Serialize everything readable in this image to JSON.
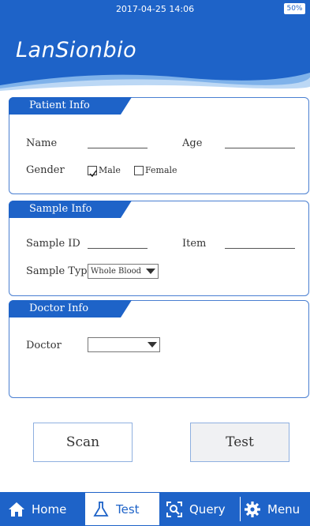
{
  "status_bar": {
    "datetime": "2017-04-25  14:06",
    "battery": "50%"
  },
  "brand": {
    "logo_text": "LanSionbio"
  },
  "patient_info": {
    "title": "Patient Info",
    "name_label": "Name",
    "age_label": "Age",
    "gender_label": "Gender",
    "male_label": "Male",
    "female_label": "Female",
    "male_checked": true,
    "female_checked": false
  },
  "sample_info": {
    "title": "Sample Info",
    "sample_id_label": "Sample ID",
    "item_label": "Item",
    "sample_type_label": "Sample Type",
    "sample_type_value": "Whole Blood"
  },
  "doctor_info": {
    "title": "Doctor Info",
    "doctor_label": "Doctor",
    "doctor_value": ""
  },
  "actions": {
    "scan_label": "Scan",
    "test_label": "Test"
  },
  "nav": {
    "items": [
      {
        "label": "Home",
        "icon": "home-icon"
      },
      {
        "label": "Test",
        "icon": "flask-icon",
        "active": true
      },
      {
        "label": "Query",
        "icon": "query-icon"
      },
      {
        "label": "Menu",
        "icon": "gear-icon"
      }
    ]
  },
  "colors": {
    "primary": "#1e63c8",
    "accent_wave": "#7fb2ea",
    "panel_border": "#4a7fd1"
  }
}
